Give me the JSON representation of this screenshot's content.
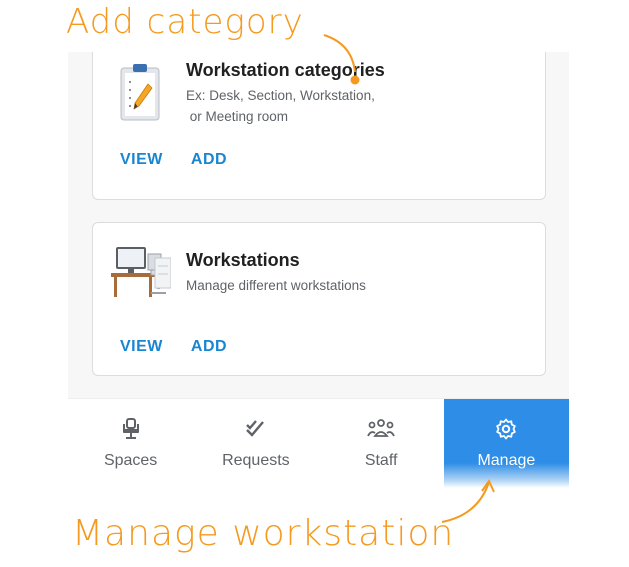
{
  "annotations": {
    "top": "Add category",
    "bottom": "Manage workstation"
  },
  "cards": [
    {
      "title": "Workstation categories",
      "description_line1": "Ex: Desk, Section, Workstation,",
      "description_line2": " or Meeting room",
      "view_label": "VIEW",
      "add_label": "ADD",
      "icon": "clipboard-icon"
    },
    {
      "title": "Workstations",
      "description_line1": "Manage different workstations",
      "view_label": "VIEW",
      "add_label": "ADD",
      "icon": "desk-icon"
    }
  ],
  "bottom_nav": [
    {
      "label": "Spaces",
      "icon": "chair-icon",
      "active": false
    },
    {
      "label": "Requests",
      "icon": "double-check-icon",
      "active": false
    },
    {
      "label": "Staff",
      "icon": "people-group-icon",
      "active": false
    },
    {
      "label": "Manage",
      "icon": "gear-icon",
      "active": true
    }
  ],
  "colors": {
    "annotation": "#f59a1f",
    "action": "#1a86d0",
    "active_tab": "#2e8de6"
  }
}
